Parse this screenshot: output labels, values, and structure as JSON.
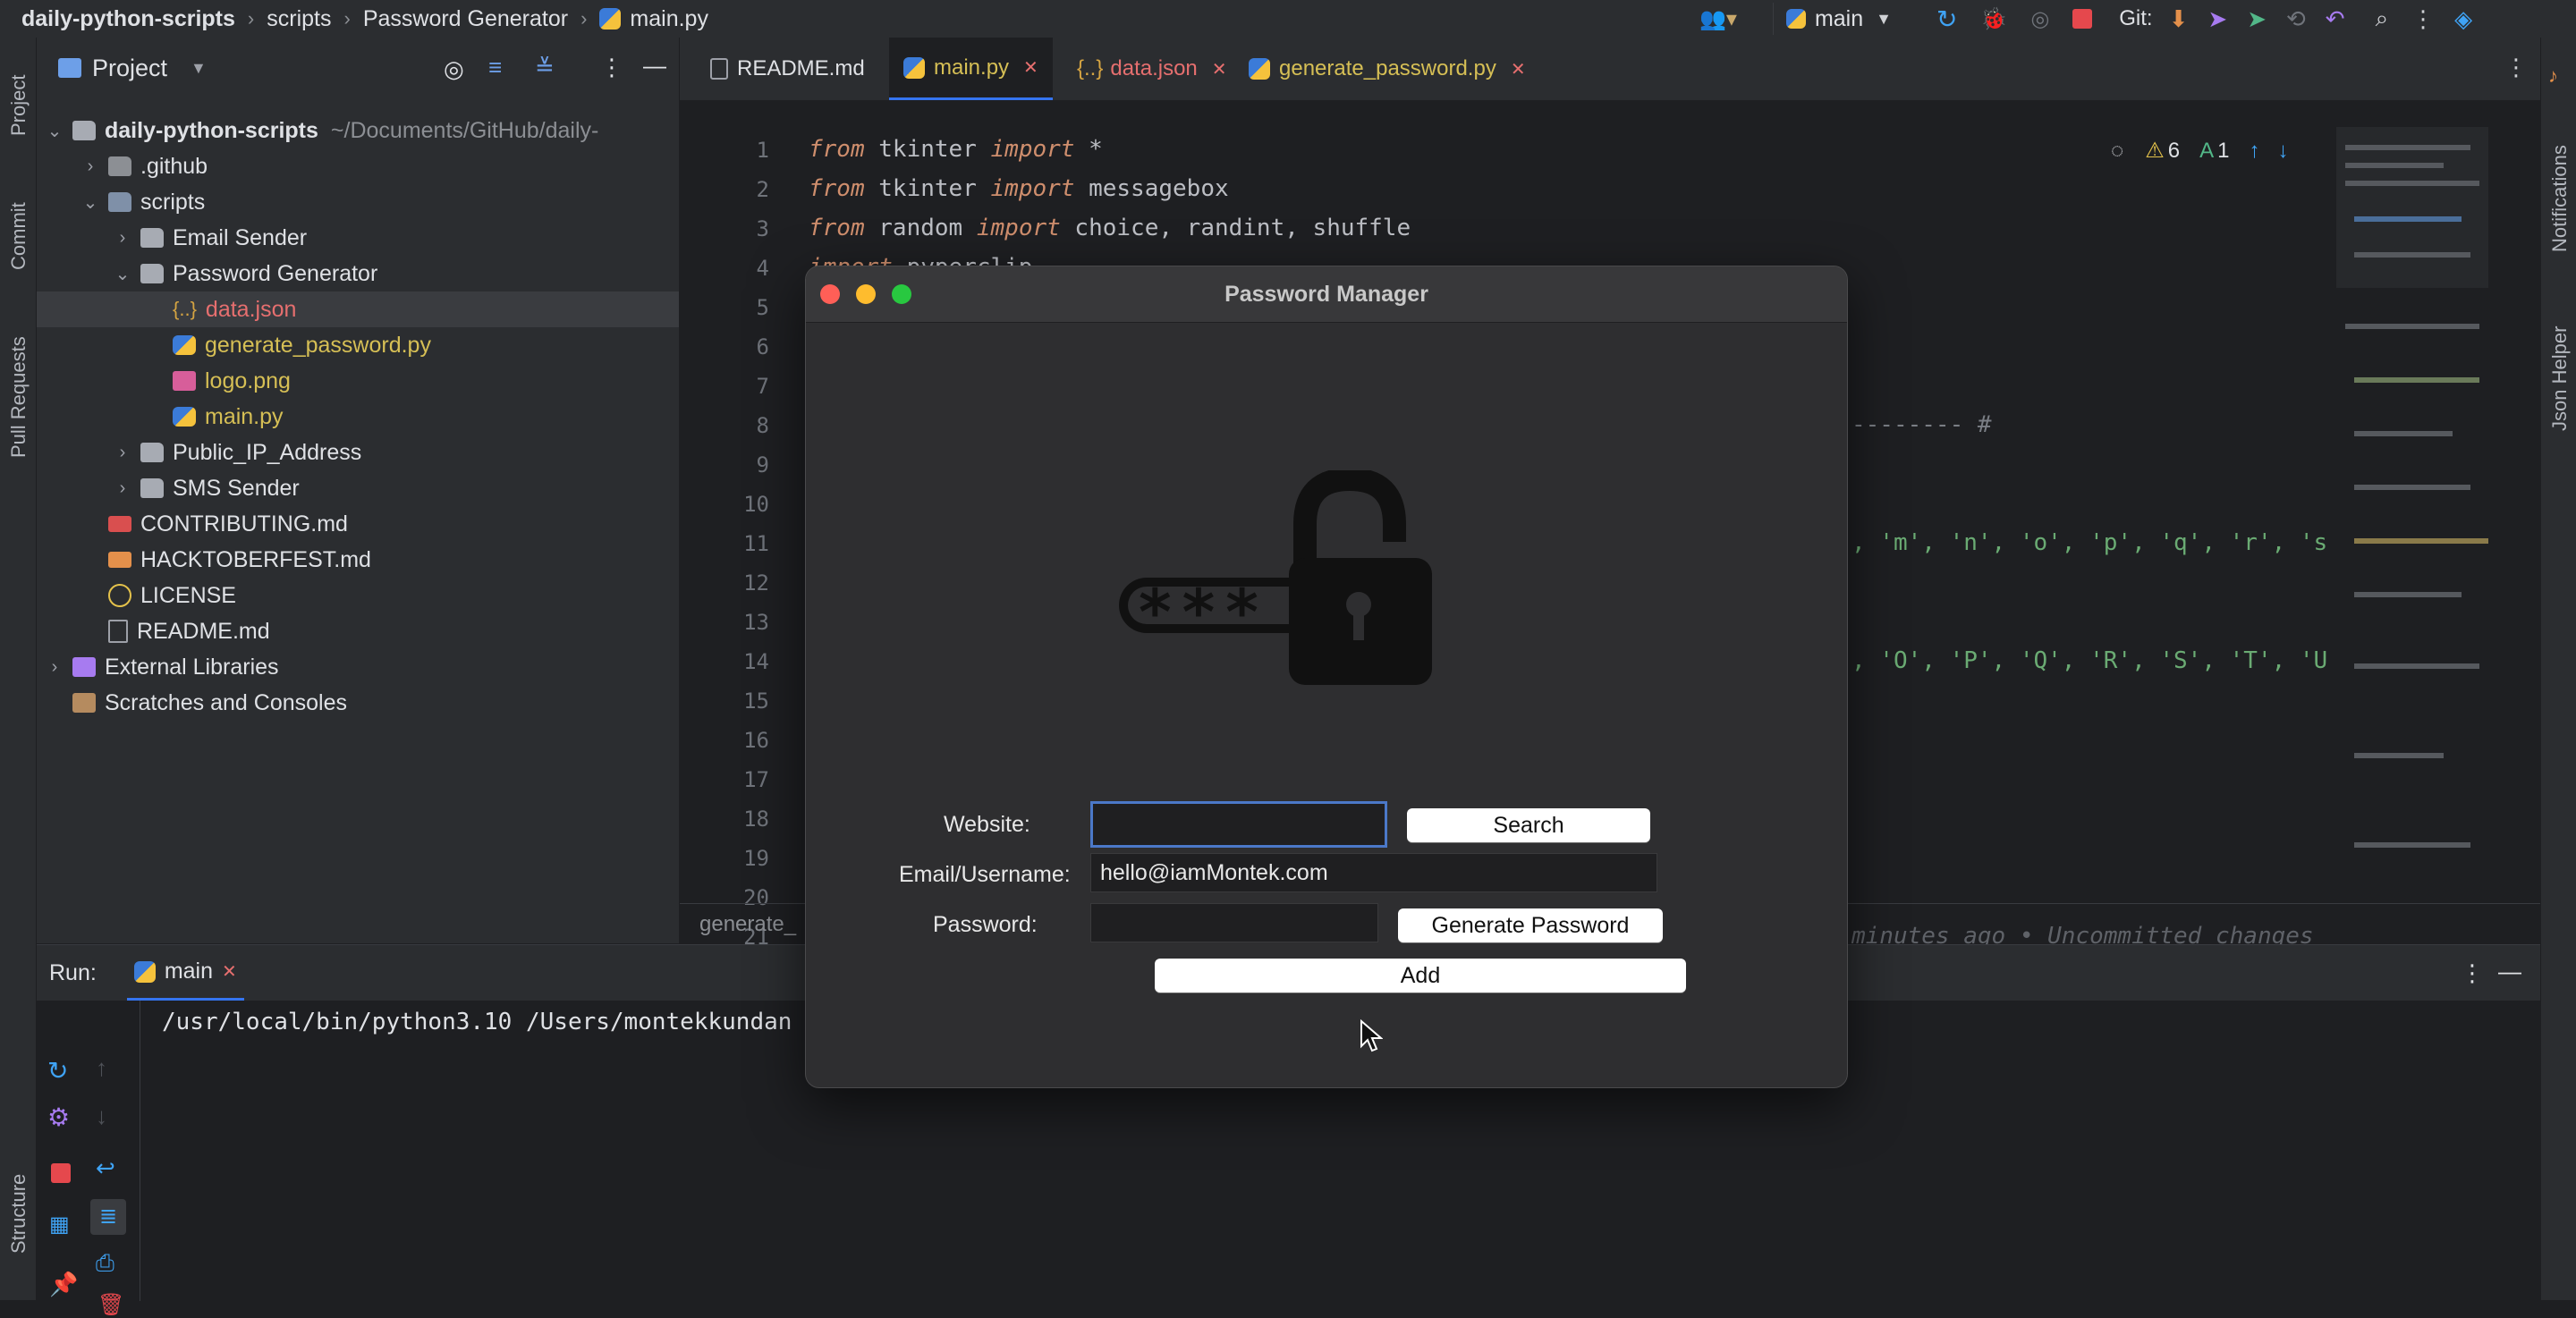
{
  "topbar": {
    "crumbs": [
      "daily-python-scripts",
      "scripts",
      "Password Generator",
      "main.py"
    ],
    "branch": "main",
    "git_label": "Git:"
  },
  "left_strip": {
    "labels": [
      "Project",
      "Commit",
      "Pull Requests",
      "Structure"
    ]
  },
  "project": {
    "title": "Project",
    "root": {
      "name": "daily-python-scripts",
      "path": "~/Documents/GitHub/daily-"
    },
    "items": [
      {
        "label": ".github"
      },
      {
        "label": "scripts"
      },
      {
        "label": "Email Sender"
      },
      {
        "label": "Password Generator"
      },
      {
        "label": "data.json"
      },
      {
        "label": "generate_password.py"
      },
      {
        "label": "logo.png"
      },
      {
        "label": "main.py"
      },
      {
        "label": "Public_IP_Address"
      },
      {
        "label": "SMS Sender"
      },
      {
        "label": "CONTRIBUTING.md"
      },
      {
        "label": "HACKTOBERFEST.md"
      },
      {
        "label": "LICENSE"
      },
      {
        "label": "README.md"
      },
      {
        "label": "External Libraries"
      },
      {
        "label": "Scratches and Consoles"
      }
    ],
    "json_glyph": "{..}"
  },
  "tabs": [
    {
      "label": "README.md"
    },
    {
      "label": "main.py"
    },
    {
      "label": "data.json"
    },
    {
      "label": "generate_password.py"
    }
  ],
  "editor": {
    "line_numbers": [
      "1",
      "2",
      "3",
      "4",
      "5",
      "6",
      "7",
      "8",
      "9",
      "10",
      "11",
      "12",
      "13",
      "14",
      "15",
      "16",
      "17",
      "18",
      "19",
      "20",
      "21"
    ],
    "lines": [
      {
        "kw": "from",
        "rest": " tkinter ",
        "kw2": "import",
        "rest2": " *"
      },
      {
        "kw": "from",
        "rest": " tkinter ",
        "kw2": "import",
        "rest2": " messagebox"
      },
      {
        "kw": "from",
        "rest": " random ",
        "kw2": "import",
        "rest2": " choice, randint, shuffle"
      },
      {
        "kw": "import",
        "rest": " pyperclip",
        "kw2": "",
        "rest2": ""
      }
    ],
    "partial_line_8": "-------- #",
    "partial_line_11": ", 'm', 'n', 'o', 'p', 'q', 'r', 's",
    "partial_line_14": ", 'O', 'P', 'Q', 'R', 'S', 'T', 'U",
    "partial_line_21": "minutes ago • Uncommitted changes",
    "inspection_warnings": "6",
    "inspection_typos": "1",
    "status_file": "generate_"
  },
  "right_strip": {
    "labels": [
      "Notifications",
      "Json Helper"
    ]
  },
  "run": {
    "label": "Run:",
    "tab": "main",
    "console": "/usr/local/bin/python3.10 /Users/montekkundan"
  },
  "dialog": {
    "title": "Password Manager",
    "website_label": "Website:",
    "website_value": "",
    "search_button": "Search",
    "email_label": "Email/Username:",
    "email_value": "hello@iamMontek.com",
    "password_label": "Password:",
    "password_value": "",
    "generate_button": "Generate Password",
    "add_button": "Add",
    "logo_text": "***"
  }
}
